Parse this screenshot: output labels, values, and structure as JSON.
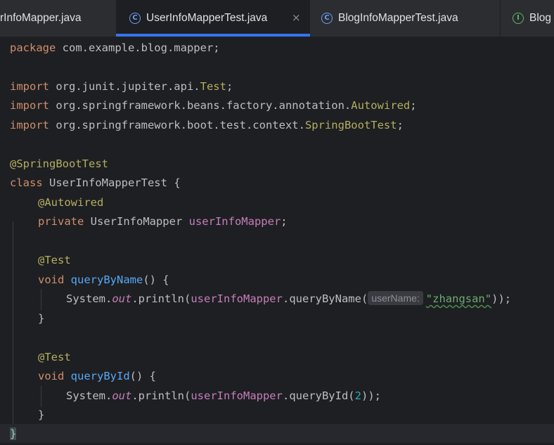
{
  "tabs": [
    {
      "label": "rInfoMapper.java",
      "active": false,
      "icon": "class-icon"
    },
    {
      "label": "UserInfoMapperTest.java",
      "active": true,
      "icon": "class-icon"
    },
    {
      "label": "BlogInfoMapperTest.java",
      "active": false,
      "icon": "class-icon"
    },
    {
      "label": "Blog",
      "active": false,
      "icon": "interface-icon"
    }
  ],
  "icons": {
    "class_glyph": "C",
    "interface_glyph": "I",
    "close_glyph": "×"
  },
  "code": {
    "l1_kw": "package",
    "l1_rest": " com.example.blog.mapper;",
    "l3_kw": "import",
    "l3_pkg": " org.junit.jupiter.api.",
    "l3_cls": "Test",
    "l3_end": ";",
    "l4_kw": "import",
    "l4_pkg": " org.springframework.beans.factory.annotation.",
    "l4_cls": "Autowired",
    "l4_end": ";",
    "l5_kw": "import",
    "l5_pkg": " org.springframework.boot.test.context.",
    "l5_cls": "SpringBootTest",
    "l5_end": ";",
    "l7_ann": "@SpringBootTest",
    "l8_kw": "class",
    "l8_name": " UserInfoMapperTest ",
    "l8_brace": "{",
    "l9_ann": "@Autowired",
    "l10_kw": "private",
    "l10_type": " UserInfoMapper ",
    "l10_field": "userInfoMapper",
    "l10_end": ";",
    "l12_ann": "@Test",
    "l13_kw": "void",
    "l13_fn": " queryByName",
    "l13_end": "() {",
    "l14_a": "System.",
    "l14_out": "out",
    "l14_b": ".println(",
    "l14_field": "userInfoMapper",
    "l14_c": ".queryByName(",
    "l14_hint": "userName:",
    "l14_str": "\"zhangsan\"",
    "l14_end": "));",
    "l15": "}",
    "l17_ann": "@Test",
    "l18_kw": "void",
    "l18_fn": " queryById",
    "l18_end": "() {",
    "l19_a": "System.",
    "l19_out": "out",
    "l19_b": ".println(",
    "l19_field": "userInfoMapper",
    "l19_c": ".queryById(",
    "l19_num": "2",
    "l19_end": "));",
    "l20": "}",
    "l21": "}"
  }
}
